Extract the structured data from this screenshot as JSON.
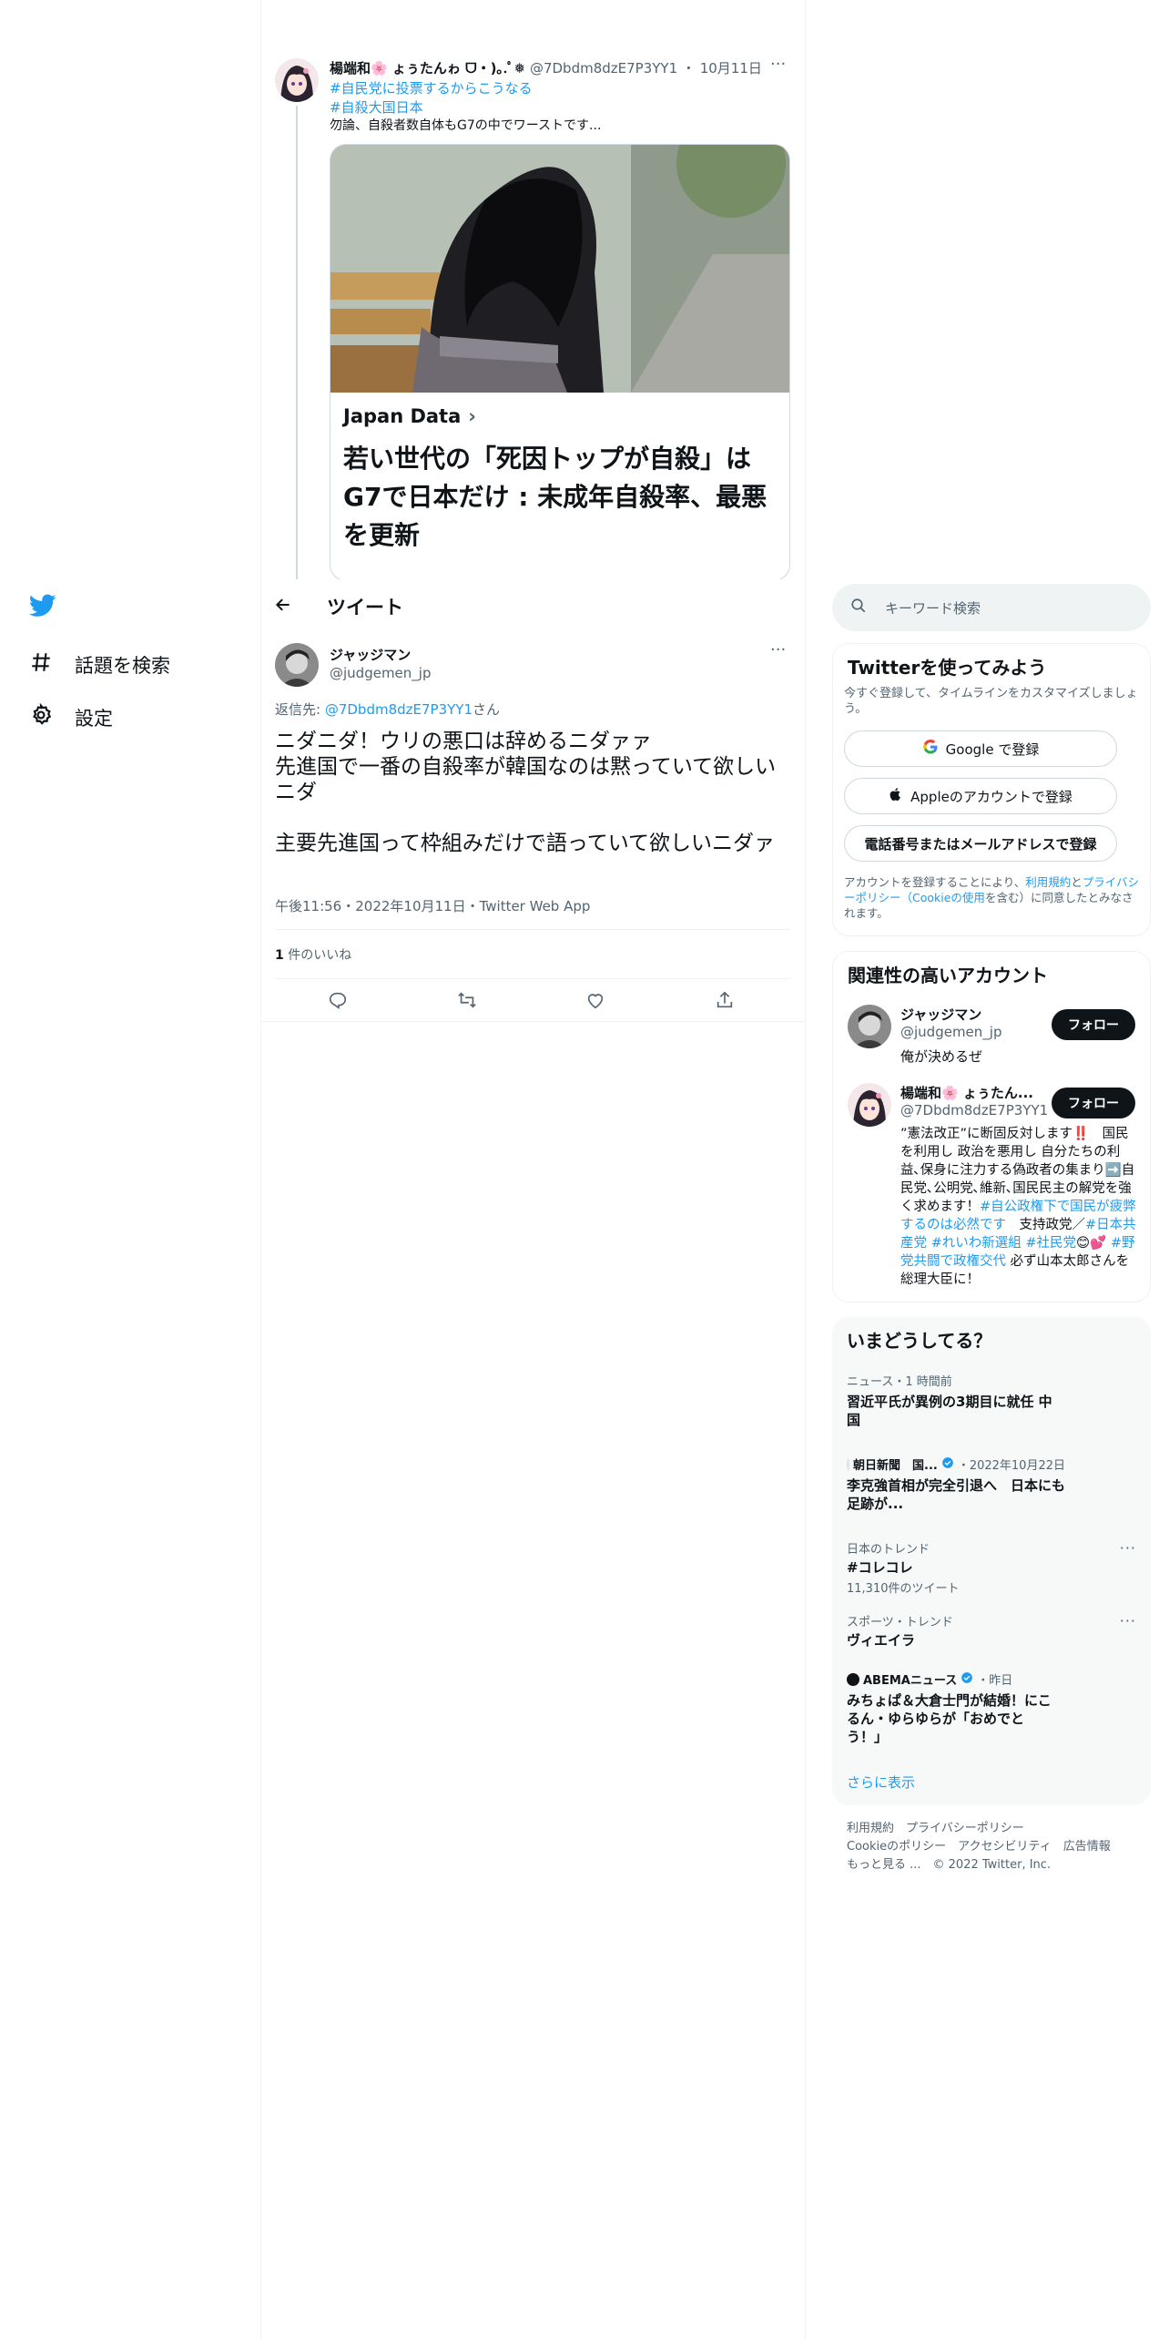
{
  "nav": {
    "logo": "twitter-bird-icon",
    "items": [
      {
        "label": "話題を検索",
        "icon": "hashtag-icon"
      },
      {
        "label": "設定",
        "icon": "gear-icon"
      }
    ]
  },
  "parent_tweet": {
    "name": "楊端和🌸 ょぅたんゎ ᗜ・)｡.ﾟ❅",
    "handle": "@7Dbdm8dzE7P3YY1",
    "date": "10月11日",
    "hashtag1": "#自民党に投票するからこうなる",
    "hashtag2": "#自殺大国日本",
    "text": "勿論、自殺者数自体もG7の中でワーストです...",
    "card": {
      "source": "Japan Data",
      "title": "若い世代の「死因トップが自殺」はG7で日本だけ : 未成年自殺率、最悪を更新"
    }
  },
  "header": {
    "title": "ツイート"
  },
  "tweet": {
    "name": "ジャッジマン",
    "handle": "@judgemen_jp",
    "reply_prefix": "返信先: ",
    "reply_to": "@7Dbdm8dzE7P3YY1",
    "reply_suffix": "さん",
    "line1": "ニダニダ！ウリの悪口は辞めるニダァァ",
    "line2": "先進国で一番の自殺率が韓国なのは黙っていて欲しいニダ",
    "line3": "主要先進国って枠組みだけで語っていて欲しいニダァ",
    "meta": "午後11:56・2022年10月11日・Twitter Web App",
    "likes_count": "1",
    "likes_label": "件のいいね"
  },
  "search": {
    "placeholder": "キーワード検索"
  },
  "signup": {
    "title": "Twitterを使ってみよう",
    "subtitle": "今すぐ登録して、タイムラインをカスタマイズしましょう。",
    "google": "Google で登録",
    "apple": "Appleのアカウントで登録",
    "phone": "電話番号またはメールアドレスで登録",
    "legal_pre": "アカウントを登録することにより、",
    "legal_terms": "利用規約",
    "legal_and": "と",
    "legal_privacy": "プライバシーポリシー（Cookieの使用",
    "legal_post": "を含む）に同意したとみなされます。"
  },
  "related": {
    "title": "関連性の高いアカウント",
    "follow_label": "フォロー",
    "accounts": [
      {
        "name": "ジャッジマン",
        "handle": "@judgemen_jp",
        "bio": "俺が決めるぜ"
      },
      {
        "name": "楊端和🌸 ょぅたん...",
        "handle": "@7Dbdm8dzE7P3YY1",
        "bio1": "”憲法改正”に断固反対します‼️　国民を利用し 政治を悪用し 自分たちの利益､保身に注力する偽政者の集まり➡️自民党､公明党､維新､国民民主の解党を強く求めます！",
        "tag1": "#自公政権下で国民が疲弊するのは必然です",
        "bio2": "　支持政党／",
        "tag2": "#日本共産党",
        "tag3": "#れいわ新選組",
        "tag4": "#社民党",
        "bio3": "😊💕",
        "tag5": "#野党共闘で政権交代",
        "bio4": " 必ず山本太郎さんを総理大臣に！"
      }
    ]
  },
  "trends": {
    "title": "いまどうしてる？",
    "items": [
      {
        "meta": "ニュース・1 時間前",
        "title": "習近平氏が異例の3期目に就任 中国"
      },
      {
        "source": "朝日新聞　国...",
        "meta": "・2022年10月22日",
        "title": "李克強首相が完全引退へ　日本にも足跡が..."
      },
      {
        "meta": "日本のトレンド",
        "title": "#コレコレ",
        "count": "11,310件のツイート"
      },
      {
        "meta": "スポーツ・トレンド",
        "title": "ヴィエイラ"
      },
      {
        "source": "ABEMAニュース",
        "meta": "・昨日",
        "title": "みちょぱ＆大倉士門が結婚！にこるん・ゆらゆらが「おめでとう！」"
      }
    ],
    "show_more": "さらに表示"
  },
  "footer": {
    "line1": "利用規約　プライバシーポリシー",
    "line2": "Cookieのポリシー　アクセシビリティ　広告情報",
    "line3": "もっと見る ...　© 2022 Twitter, Inc."
  },
  "colors": {
    "accent": "#1d9bf0",
    "text": "#0f1419",
    "muted": "#536471",
    "border": "#eff3f4"
  }
}
